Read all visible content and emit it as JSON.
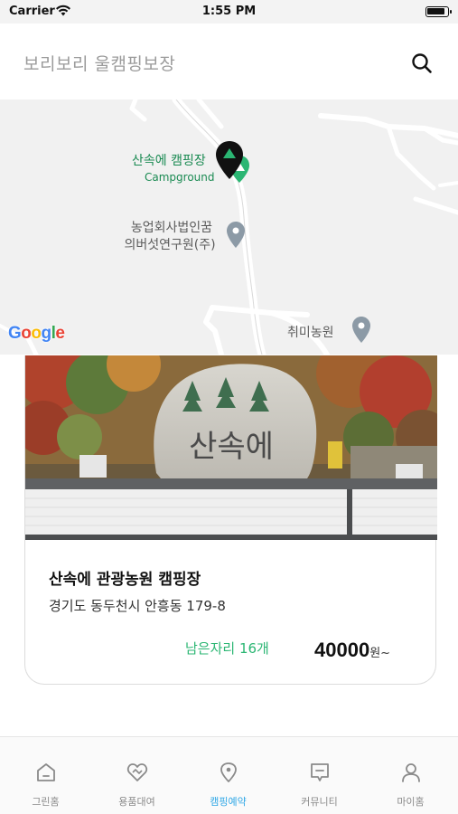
{
  "status_bar": {
    "carrier": "Carrier",
    "time": "1:55 PM"
  },
  "header": {
    "search_placeholder": "보리보리 울캠핑보장",
    "search_icon": "search-icon"
  },
  "map": {
    "markers": [
      {
        "name": "산속에 캠핑장",
        "type": "Campground",
        "color": "#1a8a52",
        "icon": "campground-pin-icon",
        "selected": true
      },
      {
        "name_line1": "농업회사법인꿈",
        "name_line2": "의버섯연구원(주)",
        "icon": "place-pin-icon"
      },
      {
        "name": "취미농원",
        "icon": "place-pin-icon"
      }
    ],
    "attribution": [
      "G",
      "o",
      "o",
      "g",
      "l",
      "e"
    ]
  },
  "card": {
    "photo_sign_text": "산속에",
    "title": "산속에 관광농원 캠핑장",
    "address": "경기도 동두천시 안흥동 179-8",
    "remaining": "남은자리 16개",
    "price": "40000",
    "price_unit": "원~"
  },
  "tabs": [
    {
      "label": "그린홈",
      "icon": "home-icon",
      "active": false
    },
    {
      "label": "용품대여",
      "icon": "heart-rental-icon",
      "active": false
    },
    {
      "label": "캠핑예약",
      "icon": "location-pin-icon",
      "active": true
    },
    {
      "label": "커뮤니티",
      "icon": "chat-icon",
      "active": false
    },
    {
      "label": "마이홈",
      "icon": "person-icon",
      "active": false
    }
  ],
  "colors": {
    "accent": "#2fa7e6",
    "available": "#2bb673",
    "map_green": "#1a8a52",
    "map_background": "#f1f1f1"
  }
}
